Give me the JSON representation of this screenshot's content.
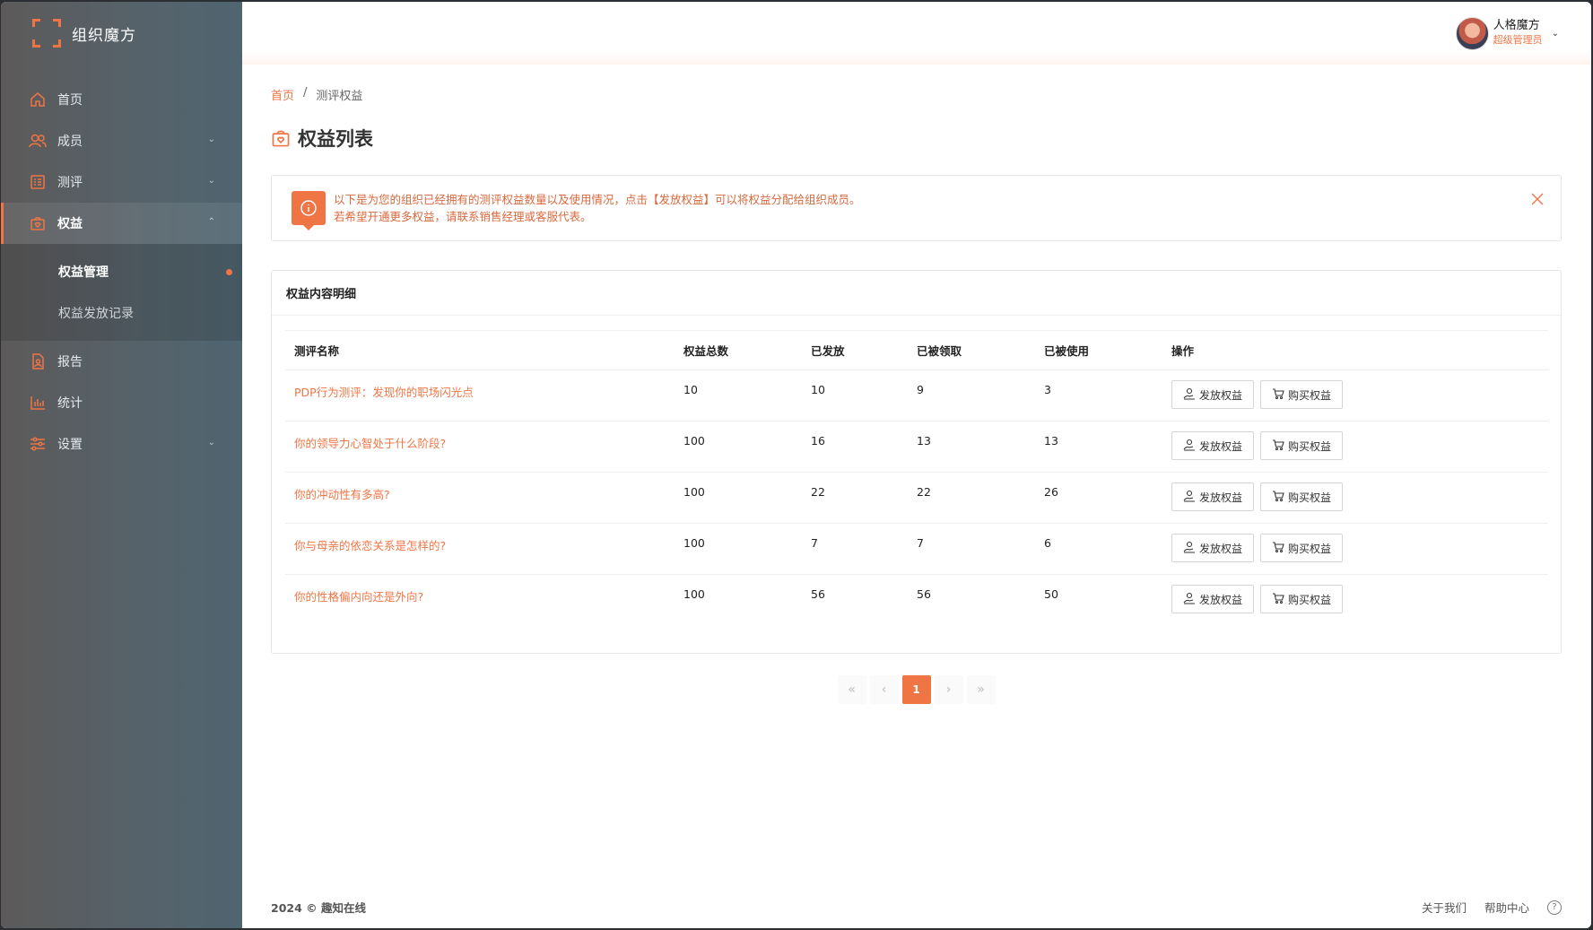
{
  "brand": {
    "name": "组织魔方"
  },
  "sidebar": {
    "items": [
      {
        "label": "首页",
        "icon": "home-icon"
      },
      {
        "label": "成员",
        "icon": "users-icon"
      },
      {
        "label": "测评",
        "icon": "assessment-icon"
      },
      {
        "label": "权益",
        "icon": "benefit-icon"
      },
      {
        "label": "报告",
        "icon": "report-icon"
      },
      {
        "label": "统计",
        "icon": "chart-icon"
      },
      {
        "label": "设置",
        "icon": "settings-icon"
      }
    ],
    "submenu": [
      {
        "label": "权益管理"
      },
      {
        "label": "权益发放记录"
      }
    ]
  },
  "user": {
    "name": "人格魔方",
    "role": "超级管理员"
  },
  "breadcrumb": {
    "home": "首页",
    "sep": "/",
    "current": "测评权益"
  },
  "page": {
    "title": "权益列表"
  },
  "alert": {
    "line1": "以下是为您的组织已经拥有的测评权益数量以及使用情况，点击【发放权益】可以将权益分配给组织成员。",
    "line2": "若希望开通更多权益，请联系销售经理或客服代表。"
  },
  "card": {
    "title": "权益内容明细"
  },
  "table": {
    "headers": [
      "测评名称",
      "权益总数",
      "已发放",
      "已被领取",
      "已被使用",
      "操作"
    ],
    "rows": [
      {
        "name": "PDP行为测评：发现你的职场闪光点",
        "total": "10",
        "issued": "10",
        "claimed": "9",
        "used": "3"
      },
      {
        "name": "你的领导力心智处于什么阶段?",
        "total": "100",
        "issued": "16",
        "claimed": "13",
        "used": "13"
      },
      {
        "name": "你的冲动性有多高?",
        "total": "100",
        "issued": "22",
        "claimed": "22",
        "used": "26"
      },
      {
        "name": "你与母亲的依恋关系是怎样的?",
        "total": "100",
        "issued": "7",
        "claimed": "7",
        "used": "6"
      },
      {
        "name": "你的性格偏内向还是外向?",
        "total": "100",
        "issued": "56",
        "claimed": "56",
        "used": "50"
      }
    ],
    "actions": {
      "issue": "发放权益",
      "buy": "购买权益"
    }
  },
  "pagination": {
    "first": "«",
    "prev": "‹",
    "current": "1",
    "next": "›",
    "last": "»"
  },
  "footer": {
    "copyright": "2024 © 趣知在线",
    "about": "关于我们",
    "help": "帮助中心",
    "help_icon": "?"
  },
  "colors": {
    "accent": "#f07545"
  }
}
